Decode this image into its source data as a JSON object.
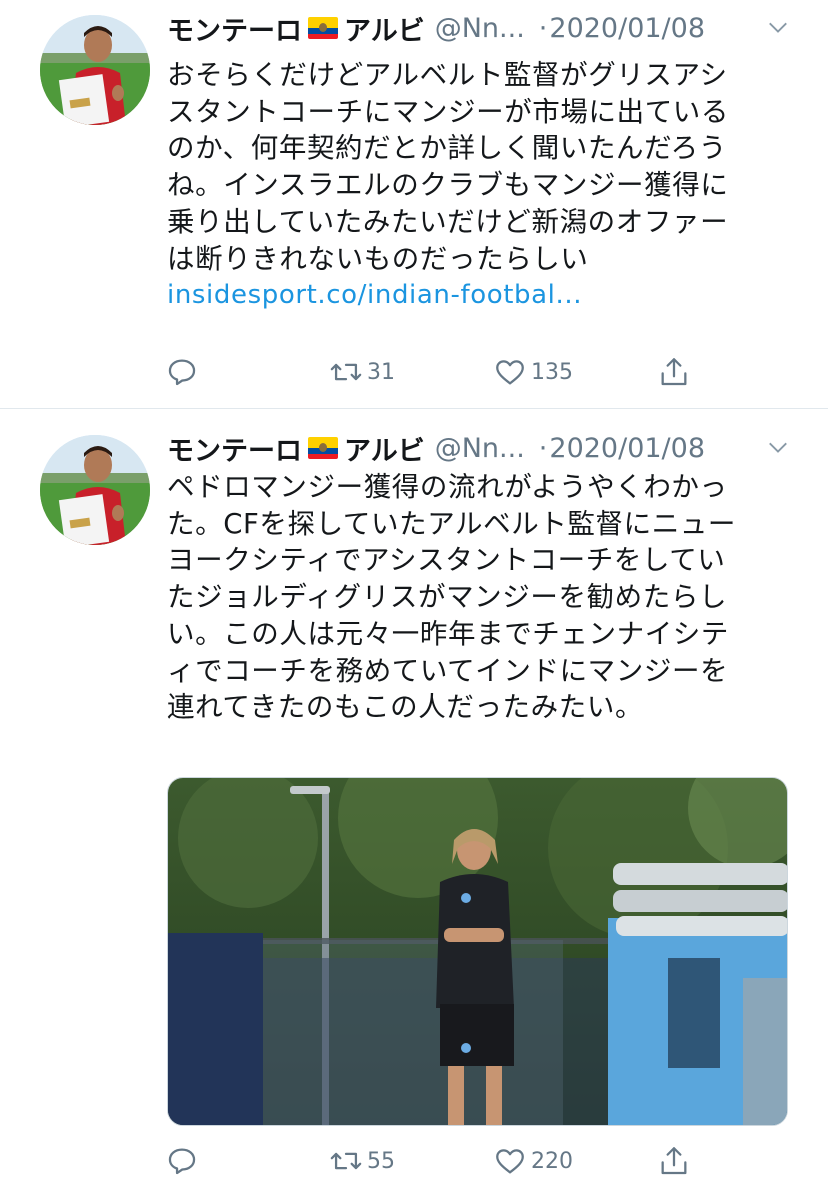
{
  "tweets": [
    {
      "display_name": "モンテーロ",
      "display_name_suffix": "アルビ",
      "flag_emoji": "ecuador-flag",
      "handle": "@Nn...",
      "separator": "·",
      "date": "2020/01/08",
      "text_lines": [
        "おそらくだけどアルベルト監督がグリスアシ",
        "スタントコーチにマンジーが市場に出ている",
        "のか、何年契約だとか詳しく聞いたんだろう",
        "ね。インスラエルのクラブもマンジー獲得に",
        "乗り出していたみたいだけど新潟のオファー",
        "は断りきれないものだったらしい"
      ],
      "link": "insidesport.co/indian-footbal...",
      "reply_count": "",
      "retweet_count": "31",
      "like_count": "135"
    },
    {
      "display_name": "モンテーロ",
      "display_name_suffix": "アルビ",
      "flag_emoji": "ecuador-flag",
      "handle": "@Nn...",
      "separator": "·",
      "date": "2020/01/08",
      "text_lines": [
        "ペドロマンジー獲得の流れがようやくわかっ",
        "た。CFを探していたアルベルト監督にニュー",
        "ヨークシティでアシスタントコーチをしてい",
        "たジョルディグリスがマンジーを勧めたらし",
        "い。この人は元々一昨年までチェンナイシテ",
        "ィでコーチを務めていてインドにマンジーを",
        "連れてきたのもこの人だったみたい。"
      ],
      "media": "photo",
      "reply_count": "",
      "retweet_count": "55",
      "like_count": "220"
    }
  ],
  "colors": {
    "text": "#14171a",
    "secondary": "#657786",
    "link": "#1b95e0",
    "divider": "#e1e8ed"
  },
  "icons": {
    "reply": "reply-icon",
    "retweet": "retweet-icon",
    "like": "heart-icon",
    "share": "share-icon",
    "caret": "chevron-down-icon"
  }
}
